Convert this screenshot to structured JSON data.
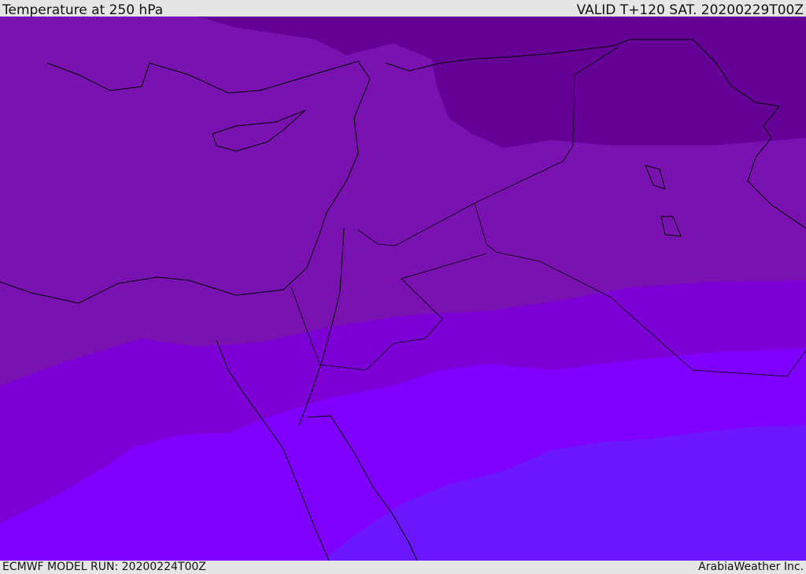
{
  "header": {
    "title": "Temperature at 250 hPa",
    "valid": "VALID T+120 SAT. 20200229T00Z"
  },
  "footer": {
    "model_run": "ECMWF MODEL RUN: 20200224T00Z",
    "credit": "ArabiaWeather Inc."
  },
  "colors": {
    "band1": "#650097",
    "band2": "#7912b0",
    "band3": "#7c00d6",
    "band4": "#8000ff",
    "band5": "#6b18ff"
  }
}
